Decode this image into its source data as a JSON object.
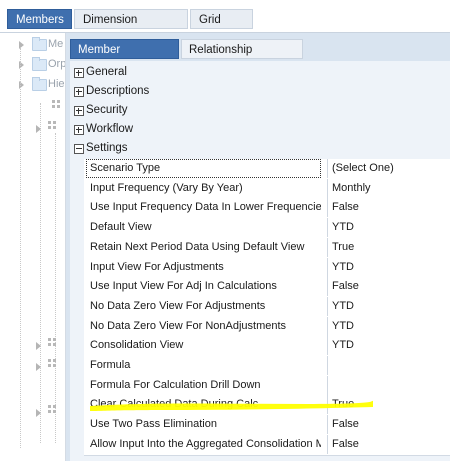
{
  "top_tabs": [
    {
      "label": "Members",
      "active": true
    },
    {
      "label": "Dimension Properties",
      "active": false
    },
    {
      "label": "Grid View",
      "active": false
    }
  ],
  "tree": {
    "items": [
      {
        "label": "Me"
      },
      {
        "label": "Orp"
      },
      {
        "label": "Hie"
      }
    ]
  },
  "sub_tabs": [
    {
      "label": "Member Properties",
      "active": true
    },
    {
      "label": "Relationship Properties",
      "active": false
    }
  ],
  "sections": [
    {
      "label": "General",
      "expanded": false
    },
    {
      "label": "Descriptions",
      "expanded": false
    },
    {
      "label": "Security",
      "expanded": false
    },
    {
      "label": "Workflow",
      "expanded": false
    },
    {
      "label": "Settings",
      "expanded": true
    }
  ],
  "properties": [
    {
      "name": "Scenario Type",
      "value": "(Select One)"
    },
    {
      "name": "Input Frequency (Vary By Year)",
      "value": "Monthly"
    },
    {
      "name": "Use Input Frequency Data In Lower Frequencies",
      "value": "False"
    },
    {
      "name": "Default View",
      "value": "YTD"
    },
    {
      "name": "Retain Next Period Data Using Default View",
      "value": "True"
    },
    {
      "name": "Input View For Adjustments",
      "value": "YTD"
    },
    {
      "name": "Use Input View For Adj In Calculations",
      "value": "False"
    },
    {
      "name": "No Data Zero View For Adjustments",
      "value": "YTD"
    },
    {
      "name": "No Data Zero View For NonAdjustments",
      "value": "YTD"
    },
    {
      "name": "Consolidation View",
      "value": "YTD"
    },
    {
      "name": "Formula",
      "value": ""
    },
    {
      "name": "Formula For Calculation Drill Down",
      "value": ""
    },
    {
      "name": "Clear Calculated Data During Calc",
      "value": "True"
    },
    {
      "name": "Use Two Pass Elimination",
      "value": "False"
    },
    {
      "name": "Allow Input Into the Aggregated Consolidation Me",
      "value": "False"
    }
  ],
  "colors": {
    "accent": "#3f6fae",
    "highlight": "#ffff00"
  }
}
